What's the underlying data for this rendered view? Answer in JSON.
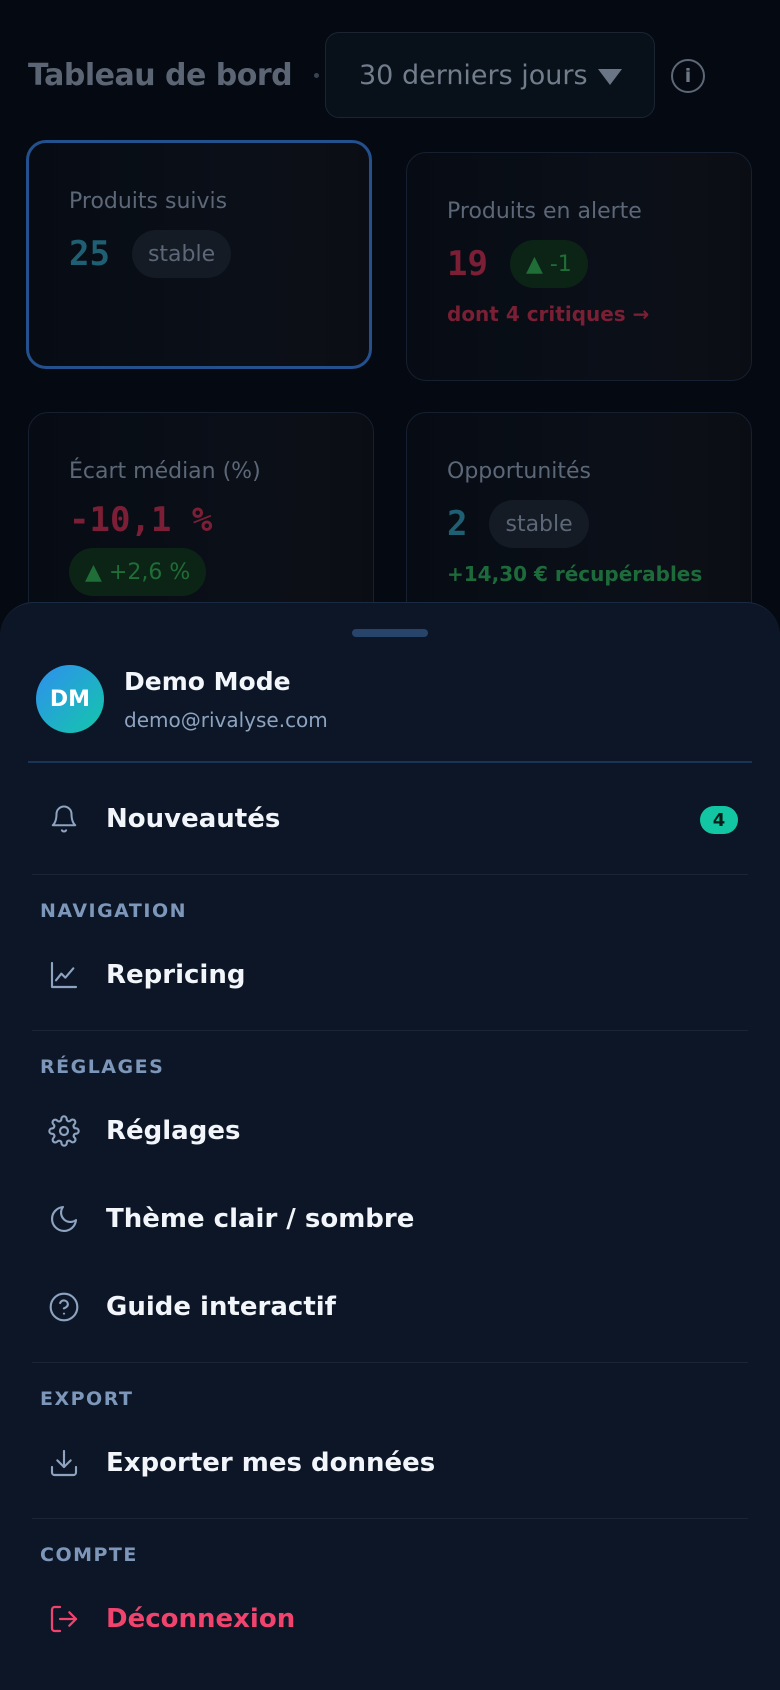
{
  "header": {
    "title": "Tableau de bord",
    "period": "30 derniers jours",
    "info_symbol": "i"
  },
  "cards": [
    {
      "label": "Produits suivis",
      "value": "25",
      "pill": "stable",
      "sub": ""
    },
    {
      "label": "Produits en alerte",
      "value": "19",
      "pill": "▲ -1",
      "sub": "dont 4 critiques →"
    },
    {
      "label": "Écart médian (%)",
      "value": "-10,1 %",
      "pill": "▲ +2,6 %",
      "sub": ""
    },
    {
      "label": "Opportunités",
      "value": "2",
      "pill": "stable",
      "sub": "+14,30 € récupérables"
    }
  ],
  "menu": {
    "profile": {
      "initials": "DM",
      "name": "Demo Mode",
      "email": "demo@rivalyse.com"
    },
    "news": {
      "label": "Nouveautés",
      "badge": "4",
      "icon": "bell-icon"
    },
    "sections": {
      "navigation": "NAVIGATION",
      "settings": "RÉGLAGES",
      "export": "EXPORT",
      "account": "COMPTE"
    },
    "items": {
      "repricing": {
        "label": "Repricing",
        "icon": "line-chart-icon"
      },
      "settings": {
        "label": "Réglages",
        "icon": "gear-icon"
      },
      "theme": {
        "label": "Thème clair / sombre",
        "icon": "moon-icon"
      },
      "guide": {
        "label": "Guide interactif",
        "icon": "help-circle-icon"
      },
      "export": {
        "label": "Exporter mes données",
        "icon": "download-icon"
      },
      "logout": {
        "label": "Déconnexion",
        "icon": "logout-icon"
      }
    }
  },
  "colors": {
    "accent": "#12c6a3",
    "danger": "#f0436e",
    "sheet_bg": "#0c1626",
    "section_label": "#7d97ba"
  }
}
